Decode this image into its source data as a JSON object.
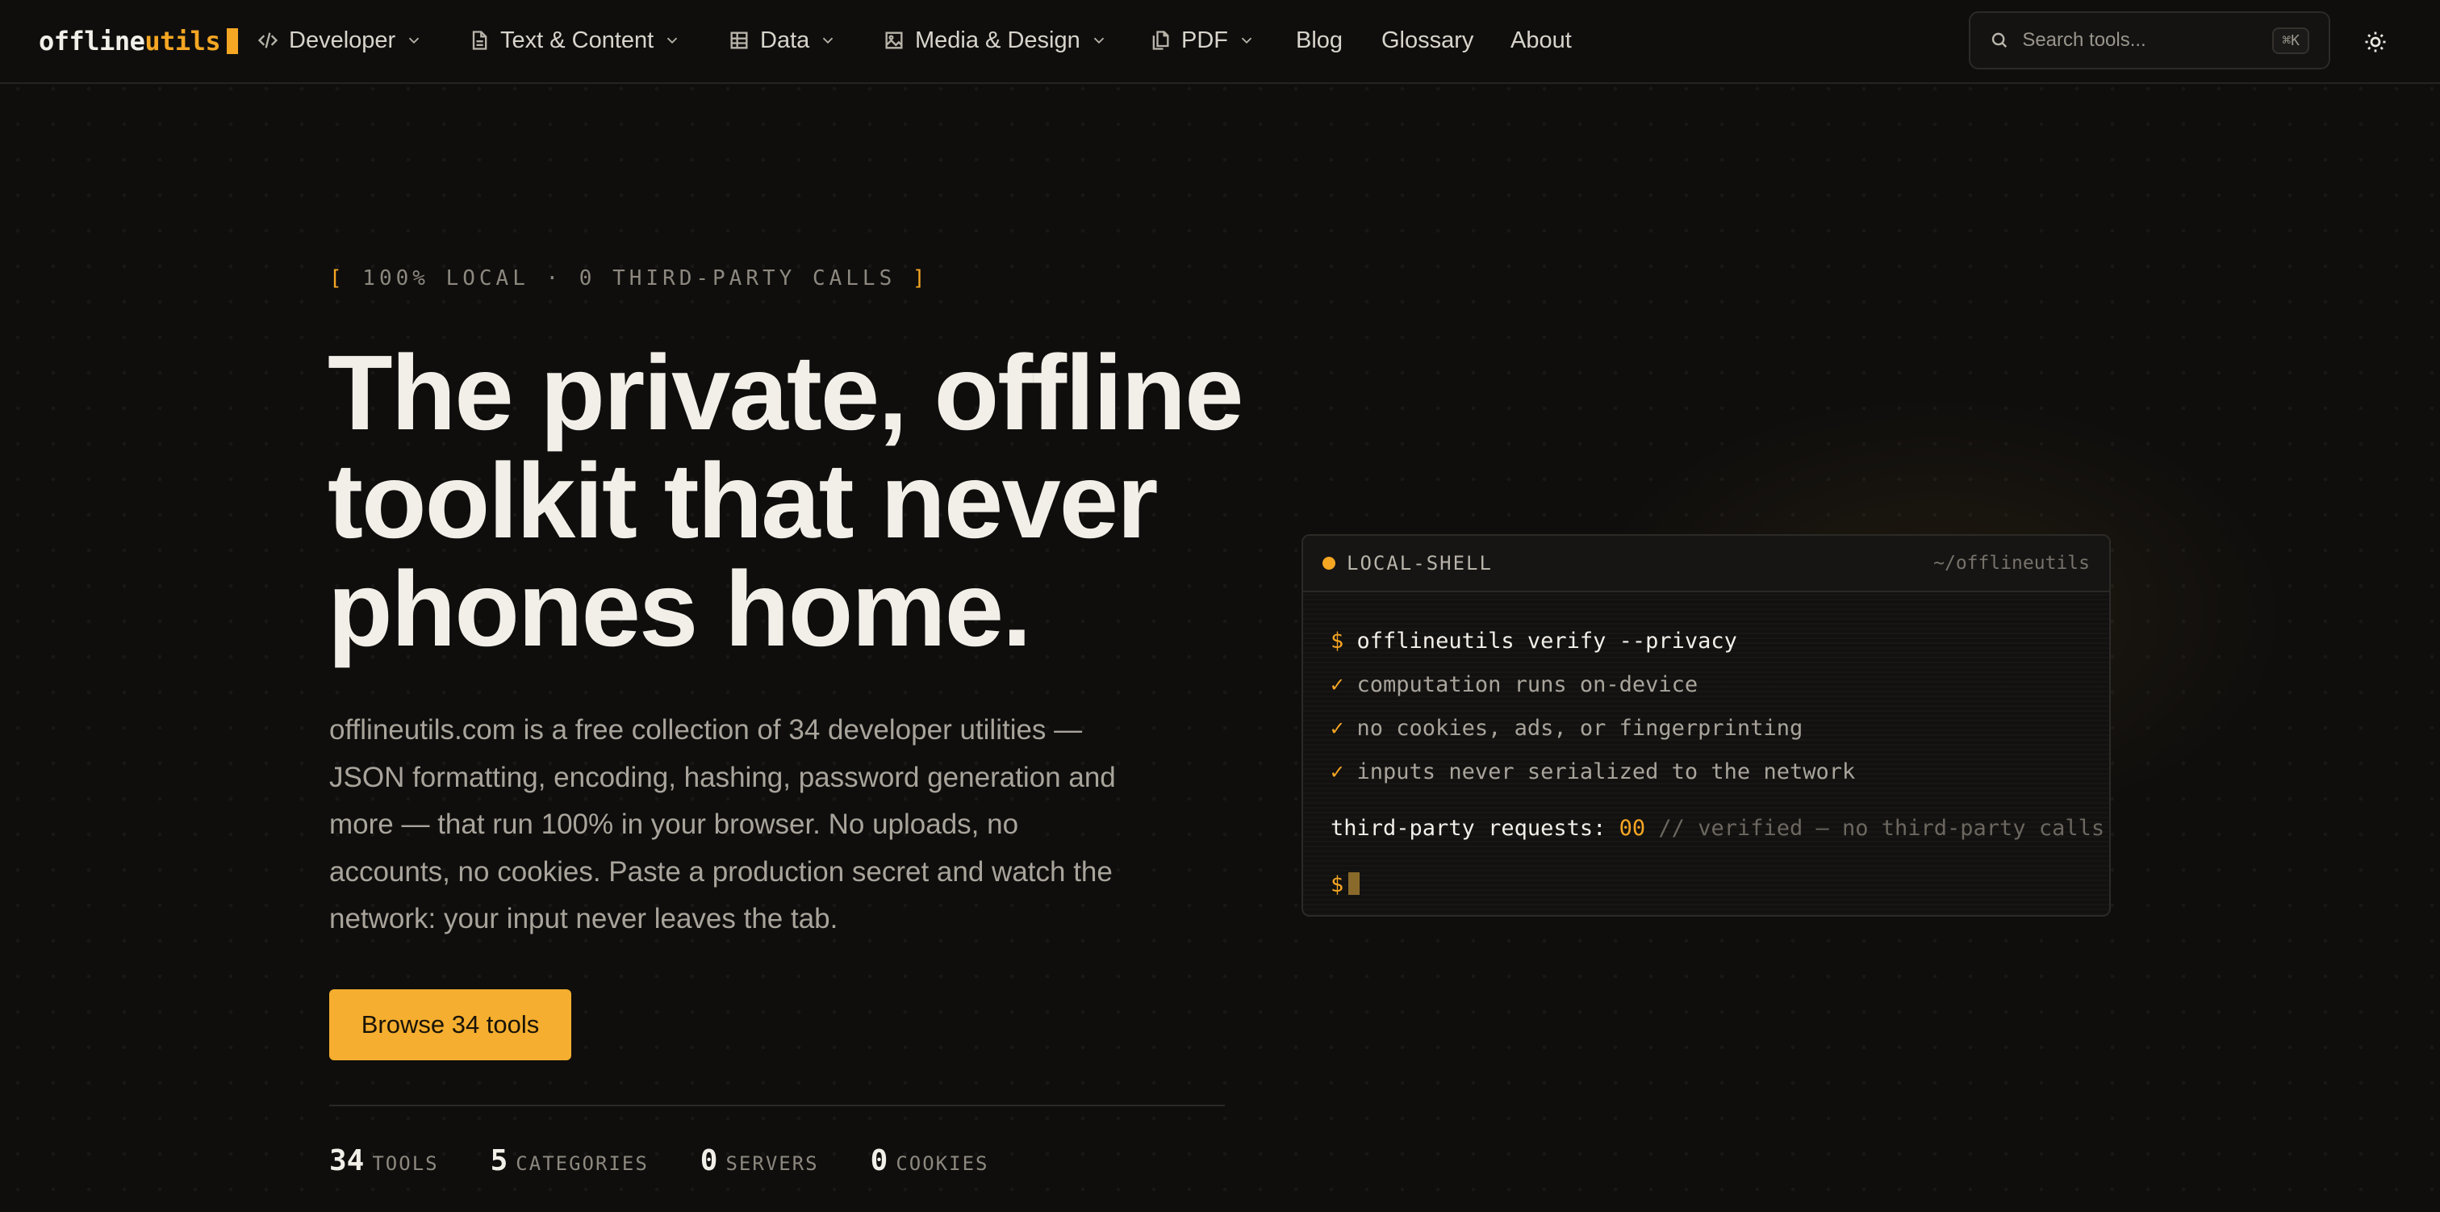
{
  "logo": {
    "part1": "offline",
    "part2": "utils"
  },
  "nav": {
    "developer": "Developer",
    "text_content": "Text & Content",
    "data": "Data",
    "media_design": "Media & Design",
    "pdf": "PDF",
    "blog": "Blog",
    "glossary": "Glossary",
    "about": "About"
  },
  "search": {
    "placeholder": "Search tools...",
    "shortcut": "⌘K"
  },
  "hero": {
    "eyebrow_open": "[",
    "eyebrow_text": " 100% LOCAL · 0 THIRD-PARTY CALLS ",
    "eyebrow_close": "]",
    "headline_line1": "The private, offline",
    "headline_line2": "toolkit that never",
    "headline_line3": "phones home.",
    "lead": "offlineutils.com is a free collection of 34 developer utilities — JSON formatting, encoding, hashing, password generation and more — that run 100% in your browser. No uploads, no accounts, no cookies. Paste a production secret and watch the network: your input never leaves the tab.",
    "cta": "Browse 34 tools"
  },
  "stats": [
    {
      "num": "34",
      "label": "TOOLS"
    },
    {
      "num": "5",
      "label": "CATEGORIES"
    },
    {
      "num": "0",
      "label": "SERVERS"
    },
    {
      "num": "0",
      "label": "COOKIES"
    }
  ],
  "terminal": {
    "title": "LOCAL-SHELL",
    "path": "~/offlineutils",
    "prompt": "$",
    "command": "offlineutils verify --privacy",
    "check": "✓",
    "checks": [
      "computation runs on-device",
      "no cookies, ads, or fingerprinting",
      "inputs never serialized to the network"
    ],
    "result_key": "third-party requests:",
    "result_value": "00",
    "result_comment": "// verified — no third-party calls"
  },
  "colors": {
    "accent": "#f5a623",
    "background": "#0f0e0d",
    "text": "#f2efe9"
  }
}
